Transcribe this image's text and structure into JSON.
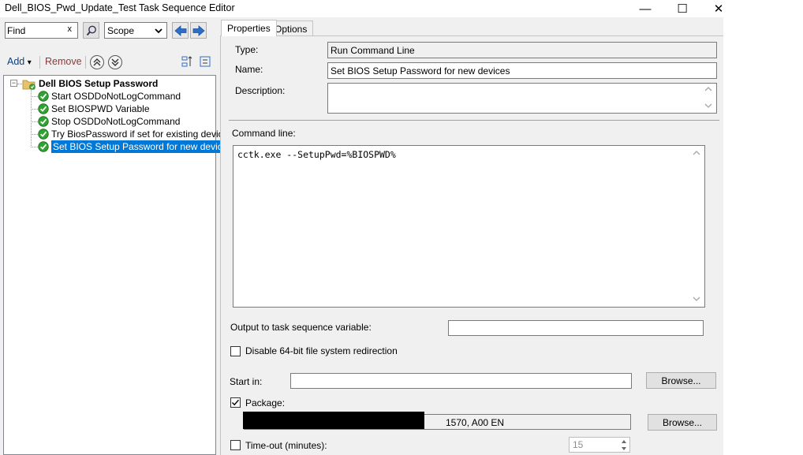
{
  "window": {
    "title": "Dell_BIOS_Pwd_Update_Test Task Sequence Editor",
    "minimize_glyph": "—",
    "maximize_glyph": "☐",
    "close_glyph": "✕"
  },
  "toolbar": {
    "find_value": "Find",
    "find_clear": "x",
    "scope_label": "Scope",
    "add_label": "Add",
    "add_dropdown": "▾",
    "remove_label": "Remove",
    "icons": [
      "search-icon",
      "chevron-down-icon",
      "arrow-left-icon",
      "arrow-right-icon",
      "move-up-icon",
      "move-down-icon",
      "collapse-icon",
      "expand-icon"
    ]
  },
  "tree": {
    "root_label": "Dell BIOS Setup Password",
    "items": [
      {
        "label": "Start OSDDoNotLogCommand"
      },
      {
        "label": "Set BIOSPWD Variable"
      },
      {
        "label": "Stop OSDDoNotLogCommand"
      },
      {
        "label": "Try BiosPassword if set for existing devices"
      },
      {
        "label": "Set BIOS Setup Password for new devices",
        "selected": true
      }
    ]
  },
  "tabs": [
    {
      "label": "Properties",
      "active": true
    },
    {
      "label": "Options",
      "active": false
    }
  ],
  "properties": {
    "type_label": "Type:",
    "type_value": "Run Command Line",
    "name_label": "Name:",
    "name_value": "Set BIOS Setup Password for new devices",
    "description_label": "Description:",
    "description_value": "",
    "command_line_label": "Command line:",
    "command_line_value": "cctk.exe --SetupPwd=%BIOSPWD%",
    "output_var_label": "Output to task sequence variable:",
    "output_var_value": "",
    "disable_redirection_label": "Disable 64-bit file system redirection",
    "disable_redirection_checked": false,
    "start_in_label": "Start in:",
    "start_in_value": "",
    "browse_label": "Browse...",
    "package_label": "Package:",
    "package_checked": true,
    "package_value_visible": "1570, A00 EN",
    "browse2_label": "Browse...",
    "timeout_label": "Time-out (minutes):",
    "timeout_checked": false,
    "timeout_value": "15"
  },
  "colors": {
    "selection": "#0078d7",
    "window_bg": "#f0f0f0",
    "link_blue": "#0a3f83",
    "check_green": "#2fa32f"
  }
}
